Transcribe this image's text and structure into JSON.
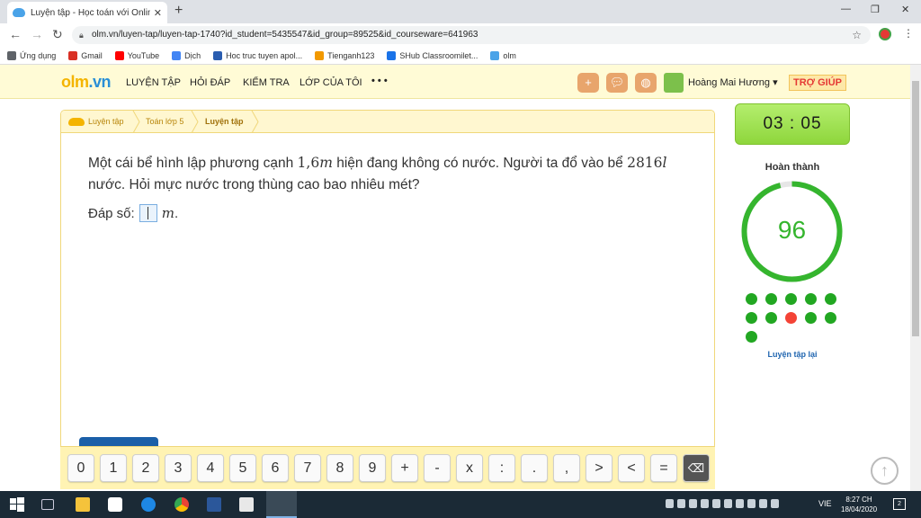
{
  "browser": {
    "tab_title": "Luyện tập - Học toán với OnlineM",
    "url": "olm.vn/luyen-tap/luyen-tap-1740?id_student=5435547&id_group=89525&id_courseware=641963",
    "bookmarks": [
      {
        "label": "Ứng dụng",
        "icon": "apps-grid-icon",
        "color": "#5f6368"
      },
      {
        "label": "Gmail",
        "icon": "gmail-icon",
        "color": "#d93025"
      },
      {
        "label": "YouTube",
        "icon": "youtube-icon",
        "color": "#ff0000"
      },
      {
        "label": "Dịch",
        "icon": "translate-icon",
        "color": "#4285f4"
      },
      {
        "label": "Hoc truc tuyen apol...",
        "icon": "apollo-icon",
        "color": "#2a5db0"
      },
      {
        "label": "Tienganh123",
        "icon": "tienganh-icon",
        "color": "#f29900"
      },
      {
        "label": "SHub Classroomilet...",
        "icon": "shub-icon",
        "color": "#1a73e8"
      },
      {
        "label": "olm",
        "icon": "olm-cloud-icon",
        "color": "#4aa3e8"
      }
    ]
  },
  "site": {
    "logo_left": "olm",
    "logo_right": ".vn",
    "menu": [
      "LUYỆN TẬP",
      "HỎI ĐÁP",
      "KIỂM TRA",
      "LỚP CỦA TÔI",
      "• • •"
    ],
    "username": "Hoàng Mai Hương ▾",
    "help_label": "TRỢ GIÚP"
  },
  "breadcrumb": [
    "Luyện tập",
    "Toán lớp 5",
    "Luyện tập"
  ],
  "question": {
    "part1": "Một cái bể hình lập phương cạnh ",
    "edge": "1,6",
    "edge_unit": "m",
    "part2": " hiện đang không có nước. Người ta đổ vào bể ",
    "volume": "2816",
    "volume_unit": "l",
    "part3": " nước. Hỏi mực nước trong thùng cao bao nhiêu mét?",
    "answer_label": "Đáp số:",
    "answer_value": "",
    "answer_unit": "m",
    "answer_end": "."
  },
  "keypad": [
    "0",
    "1",
    "2",
    "3",
    "4",
    "5",
    "6",
    "7",
    "8",
    "9",
    "+",
    "-",
    "x",
    ":",
    ".",
    ",",
    ">",
    "<",
    "=",
    "⌫"
  ],
  "side": {
    "timer": "03 : 05",
    "done_label": "Hoàn thành",
    "score": "96",
    "progress_fraction": 0.96,
    "results": [
      "correct",
      "correct",
      "correct",
      "correct",
      "correct",
      "correct",
      "correct",
      "wrong",
      "correct",
      "correct",
      "correct"
    ],
    "correct_color": "#22a722",
    "wrong_color": "#f44336",
    "retry_label": "Luyện tập lại"
  },
  "taskbar": {
    "lang": "VIE",
    "time": "8:27 CH",
    "date": "18/04/2020",
    "notifications": "2"
  }
}
